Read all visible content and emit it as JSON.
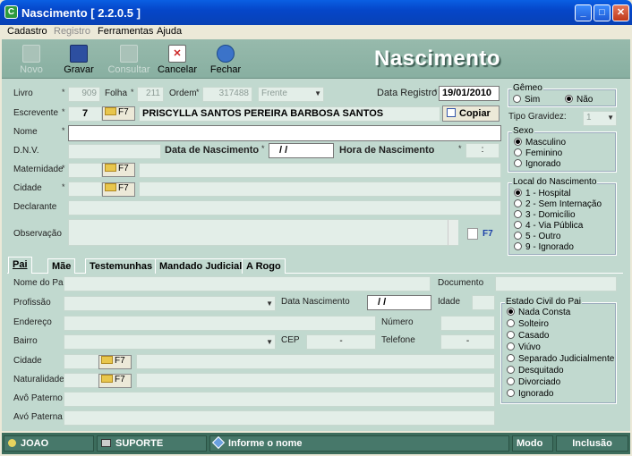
{
  "window": {
    "title": "Nascimento [ 2.2.0.5 ]",
    "icon": "app-icon",
    "min": "_",
    "max": "□",
    "close": "✕"
  },
  "menu": [
    "Cadastro",
    "Registro",
    "Ferramentas",
    "Ajuda"
  ],
  "toolbar": {
    "novo": "Novo",
    "gravar": "Gravar",
    "consultar": "Consultar",
    "cancelar": "Cancelar",
    "fechar": "Fechar"
  },
  "banner": "Nascimento",
  "registro": {
    "livro_label": "Livro",
    "livro": "909",
    "folha_label": "Folha",
    "folha": "211",
    "ordem_label": "Ordem",
    "ordem": "317488",
    "frente": "Frente",
    "data_registro_label": "Data Registro",
    "data_registro": "19/01/2010",
    "escrevente_label": "Escrevente",
    "escrevente_id": "7",
    "escrevente_nome": "PRISCYLLA SANTOS PEREIRA BARBOSA SANTOS",
    "copiar": "Copiar"
  },
  "f7": "F7",
  "crianca": {
    "nome_label": "Nome",
    "dnv_label": "D.N.V.",
    "data_nasc_label": "Data de Nascimento",
    "data_nasc": "/ /",
    "hora_nasc_label": "Hora de Nascimento",
    "hora_nasc": ":",
    "maternidade_label": "Maternidade",
    "cidade_label": "Cidade",
    "declarante_label": "Declarante",
    "observacao_label": "Observação"
  },
  "gemeo": {
    "title": "Gêmeo",
    "sim": "Sim",
    "nao": "Não",
    "tipo_label": "Tipo Gravidez:",
    "tipo": "1"
  },
  "sexo": {
    "title": "Sexo",
    "options": [
      "Masculino",
      "Feminino",
      "Ignorado"
    ]
  },
  "local": {
    "title": "Local do Nascimento",
    "options": [
      "1 - Hospital",
      "2 - Sem Internação",
      "3 - Domicílio",
      "4 - Via Pública",
      "5 - Outro",
      "9 - Ignorado"
    ]
  },
  "tabs": [
    "Pai",
    "Mãe",
    "Testemunhas",
    "Mandado Judicial",
    "A Rogo"
  ],
  "pai": {
    "nome_label": "Nome do Pai",
    "documento_label": "Documento",
    "profissao_label": "Profissão",
    "data_nasc_label": "Data Nascimento",
    "data_nasc": "/ /",
    "idade_label": "Idade",
    "endereco_label": "Endereço",
    "numero_label": "Número",
    "bairro_label": "Bairro",
    "cep_label": "CEP",
    "cep": "-",
    "telefone_label": "Telefone",
    "telefone": "-",
    "cidade_label": "Cidade",
    "naturalidade_label": "Naturalidade",
    "avo_paterno_label": "Avô Paterno",
    "avo_paterna_label": "Avó Paterna"
  },
  "estado_civil": {
    "title": "Estado Civil do Pai",
    "options": [
      "Nada Consta",
      "Solteiro",
      "Casado",
      "Viúvo",
      "Separado Judicialmente",
      "Desquitado",
      "Divorciado",
      "Ignorado"
    ]
  },
  "status": {
    "user": "JOAO",
    "server": "SUPORTE",
    "hint": "Informe o nome",
    "modo": "Modo",
    "mode_value": "Inclusão"
  }
}
